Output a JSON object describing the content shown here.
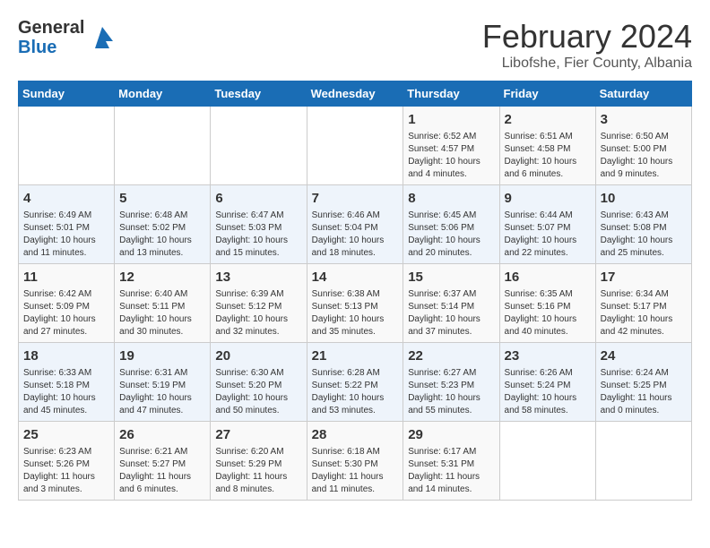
{
  "header": {
    "logo_general": "General",
    "logo_blue": "Blue",
    "title": "February 2024",
    "subtitle": "Libofshe, Fier County, Albania"
  },
  "days_of_week": [
    "Sunday",
    "Monday",
    "Tuesday",
    "Wednesday",
    "Thursday",
    "Friday",
    "Saturday"
  ],
  "weeks": [
    [
      {
        "day": "",
        "info": ""
      },
      {
        "day": "",
        "info": ""
      },
      {
        "day": "",
        "info": ""
      },
      {
        "day": "",
        "info": ""
      },
      {
        "day": "1",
        "info": "Sunrise: 6:52 AM\nSunset: 4:57 PM\nDaylight: 10 hours\nand 4 minutes."
      },
      {
        "day": "2",
        "info": "Sunrise: 6:51 AM\nSunset: 4:58 PM\nDaylight: 10 hours\nand 6 minutes."
      },
      {
        "day": "3",
        "info": "Sunrise: 6:50 AM\nSunset: 5:00 PM\nDaylight: 10 hours\nand 9 minutes."
      }
    ],
    [
      {
        "day": "4",
        "info": "Sunrise: 6:49 AM\nSunset: 5:01 PM\nDaylight: 10 hours\nand 11 minutes."
      },
      {
        "day": "5",
        "info": "Sunrise: 6:48 AM\nSunset: 5:02 PM\nDaylight: 10 hours\nand 13 minutes."
      },
      {
        "day": "6",
        "info": "Sunrise: 6:47 AM\nSunset: 5:03 PM\nDaylight: 10 hours\nand 15 minutes."
      },
      {
        "day": "7",
        "info": "Sunrise: 6:46 AM\nSunset: 5:04 PM\nDaylight: 10 hours\nand 18 minutes."
      },
      {
        "day": "8",
        "info": "Sunrise: 6:45 AM\nSunset: 5:06 PM\nDaylight: 10 hours\nand 20 minutes."
      },
      {
        "day": "9",
        "info": "Sunrise: 6:44 AM\nSunset: 5:07 PM\nDaylight: 10 hours\nand 22 minutes."
      },
      {
        "day": "10",
        "info": "Sunrise: 6:43 AM\nSunset: 5:08 PM\nDaylight: 10 hours\nand 25 minutes."
      }
    ],
    [
      {
        "day": "11",
        "info": "Sunrise: 6:42 AM\nSunset: 5:09 PM\nDaylight: 10 hours\nand 27 minutes."
      },
      {
        "day": "12",
        "info": "Sunrise: 6:40 AM\nSunset: 5:11 PM\nDaylight: 10 hours\nand 30 minutes."
      },
      {
        "day": "13",
        "info": "Sunrise: 6:39 AM\nSunset: 5:12 PM\nDaylight: 10 hours\nand 32 minutes."
      },
      {
        "day": "14",
        "info": "Sunrise: 6:38 AM\nSunset: 5:13 PM\nDaylight: 10 hours\nand 35 minutes."
      },
      {
        "day": "15",
        "info": "Sunrise: 6:37 AM\nSunset: 5:14 PM\nDaylight: 10 hours\nand 37 minutes."
      },
      {
        "day": "16",
        "info": "Sunrise: 6:35 AM\nSunset: 5:16 PM\nDaylight: 10 hours\nand 40 minutes."
      },
      {
        "day": "17",
        "info": "Sunrise: 6:34 AM\nSunset: 5:17 PM\nDaylight: 10 hours\nand 42 minutes."
      }
    ],
    [
      {
        "day": "18",
        "info": "Sunrise: 6:33 AM\nSunset: 5:18 PM\nDaylight: 10 hours\nand 45 minutes."
      },
      {
        "day": "19",
        "info": "Sunrise: 6:31 AM\nSunset: 5:19 PM\nDaylight: 10 hours\nand 47 minutes."
      },
      {
        "day": "20",
        "info": "Sunrise: 6:30 AM\nSunset: 5:20 PM\nDaylight: 10 hours\nand 50 minutes."
      },
      {
        "day": "21",
        "info": "Sunrise: 6:28 AM\nSunset: 5:22 PM\nDaylight: 10 hours\nand 53 minutes."
      },
      {
        "day": "22",
        "info": "Sunrise: 6:27 AM\nSunset: 5:23 PM\nDaylight: 10 hours\nand 55 minutes."
      },
      {
        "day": "23",
        "info": "Sunrise: 6:26 AM\nSunset: 5:24 PM\nDaylight: 10 hours\nand 58 minutes."
      },
      {
        "day": "24",
        "info": "Sunrise: 6:24 AM\nSunset: 5:25 PM\nDaylight: 11 hours\nand 0 minutes."
      }
    ],
    [
      {
        "day": "25",
        "info": "Sunrise: 6:23 AM\nSunset: 5:26 PM\nDaylight: 11 hours\nand 3 minutes."
      },
      {
        "day": "26",
        "info": "Sunrise: 6:21 AM\nSunset: 5:27 PM\nDaylight: 11 hours\nand 6 minutes."
      },
      {
        "day": "27",
        "info": "Sunrise: 6:20 AM\nSunset: 5:29 PM\nDaylight: 11 hours\nand 8 minutes."
      },
      {
        "day": "28",
        "info": "Sunrise: 6:18 AM\nSunset: 5:30 PM\nDaylight: 11 hours\nand 11 minutes."
      },
      {
        "day": "29",
        "info": "Sunrise: 6:17 AM\nSunset: 5:31 PM\nDaylight: 11 hours\nand 14 minutes."
      },
      {
        "day": "",
        "info": ""
      },
      {
        "day": "",
        "info": ""
      }
    ]
  ]
}
